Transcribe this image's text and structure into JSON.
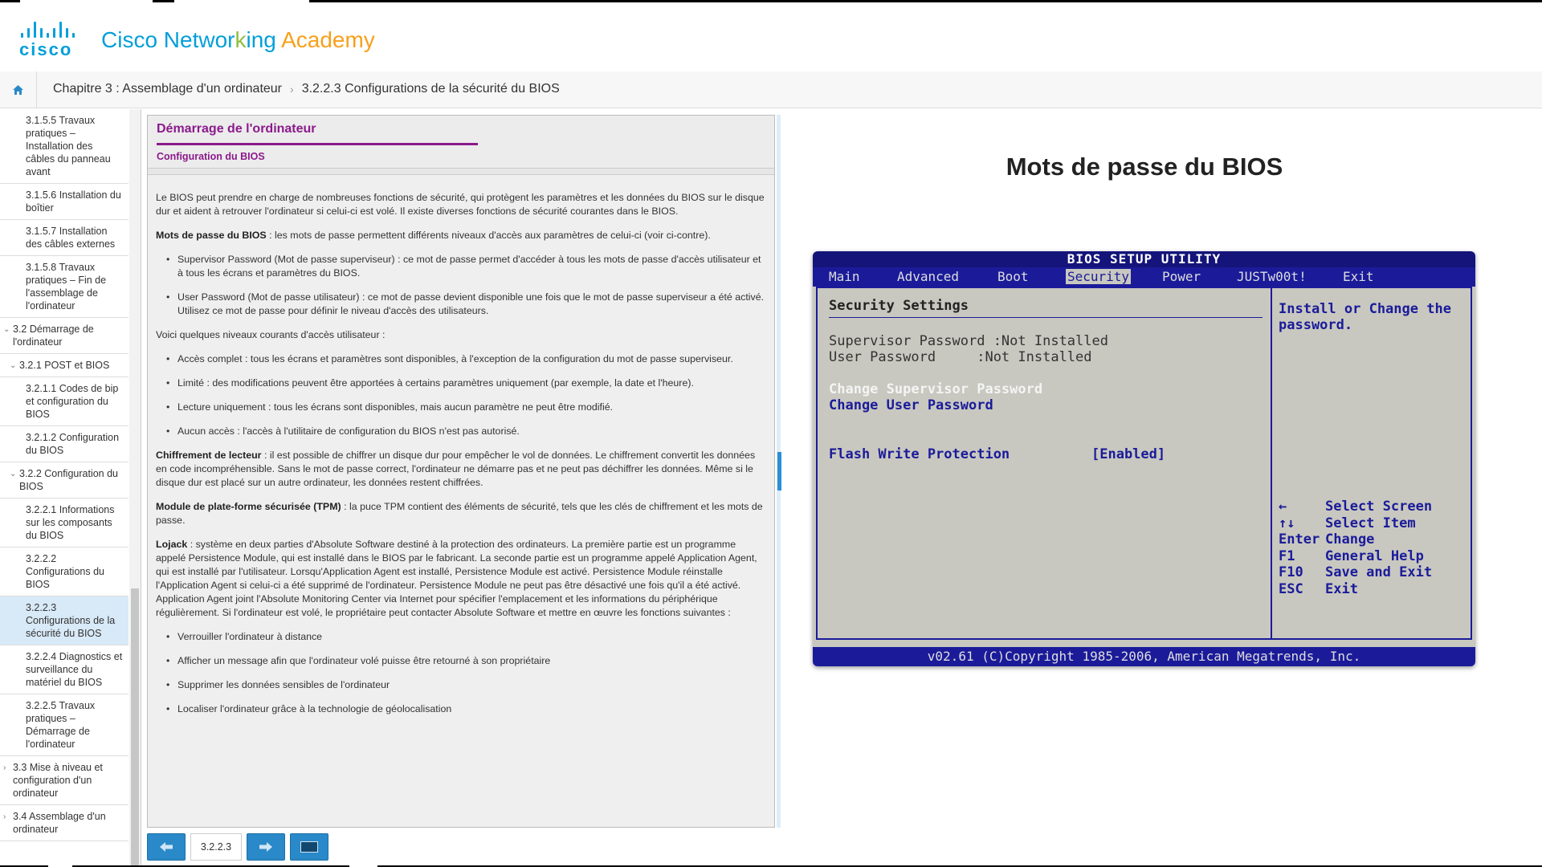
{
  "app": {
    "brand_word": "cisco",
    "title_prefix": "Cisco Networ",
    "title_o": "k",
    "title_mid": "ing",
    "title_a": " Academy"
  },
  "breadcrumb": {
    "items": [
      "Chapitre 3 : Assemblage d'un ordinateur",
      "3.2.2.3 Configurations de la sécurité du BIOS"
    ]
  },
  "sidebar": {
    "items": [
      {
        "label": "3.1.5.5 Travaux pratiques – Installation des câbles du panneau avant",
        "level": 3,
        "active": false
      },
      {
        "label": "3.1.5.6 Installation du boîtier",
        "level": 3,
        "active": false
      },
      {
        "label": "3.1.5.7 Installation des câbles externes",
        "level": 3,
        "active": false
      },
      {
        "label": "3.1.5.8 Travaux pratiques – Fin de l'assemblage de l'ordinateur",
        "level": 3,
        "active": false
      },
      {
        "label": "3.2 Démarrage de l'ordinateur",
        "level": 1,
        "chevron": "down",
        "active": false
      },
      {
        "label": "3.2.1 POST et BIOS",
        "level": 2,
        "chevron": "down",
        "active": false
      },
      {
        "label": "3.2.1.1 Codes de bip et configuration du BIOS",
        "level": 3,
        "active": false
      },
      {
        "label": "3.2.1.2 Configuration du BIOS",
        "level": 3,
        "active": false
      },
      {
        "label": "3.2.2 Configuration du BIOS",
        "level": 2,
        "chevron": "down",
        "active": false
      },
      {
        "label": "3.2.2.1 Informations sur les composants du BIOS",
        "level": 3,
        "active": false
      },
      {
        "label": "3.2.2.2 Configurations du BIOS",
        "level": 3,
        "active": false
      },
      {
        "label": "3.2.2.3 Configurations de la sécurité du BIOS",
        "level": 3,
        "active": true
      },
      {
        "label": "3.2.2.4 Diagnostics et surveillance du matériel du BIOS",
        "level": 3,
        "active": false
      },
      {
        "label": "3.2.2.5 Travaux pratiques – Démarrage de l'ordinateur",
        "level": 3,
        "active": false
      },
      {
        "label": "3.3 Mise à niveau et configuration d'un ordinateur",
        "level": 1,
        "chevron": "right",
        "active": false
      },
      {
        "label": "3.4 Assemblage d'un ordinateur",
        "level": 1,
        "chevron": "right",
        "active": false
      }
    ]
  },
  "panel": {
    "title": "Démarrage de l'ordinateur",
    "subtitle": "Configuration du BIOS",
    "intro": "Le BIOS peut prendre en charge de nombreuses fonctions de sécurité, qui protègent les paramètres et les données du BIOS sur le disque dur et aident à retrouver l'ordinateur si celui-ci est volé. Il existe diverses fonctions de sécurité courantes dans le BIOS.",
    "pw_term": "Mots de passe du BIOS",
    "pw_text": " : les mots de passe permettent différents niveaux d'accès aux paramètres de celui-ci (voir ci-contre).",
    "pw_list": [
      "Supervisor Password (Mot de passe superviseur) : ce mot de passe permet d'accéder à tous les mots de passe d'accès utilisateur et à tous les écrans et paramètres du BIOS.",
      "User Password (Mot de passe utilisateur) : ce mot de passe devient disponible une fois que le mot de passe superviseur a été activé. Utilisez ce mot de passe pour définir le niveau d'accès des utilisateurs."
    ],
    "levels_intro": "Voici quelques niveaux courants d'accès utilisateur :",
    "levels_list": [
      "Accès complet : tous les écrans et paramètres sont disponibles, à l'exception de la configuration du mot de passe superviseur.",
      "Limité : des modifications peuvent être apportées à certains paramètres uniquement (par exemple, la date et l'heure).",
      "Lecture uniquement : tous les écrans sont disponibles, mais aucun paramètre ne peut être modifié.",
      "Aucun accès : l'accès à l'utilitaire de configuration du BIOS n'est pas autorisé."
    ],
    "enc_term": "Chiffrement de lecteur",
    "enc_text": " : il est possible de chiffrer un disque dur pour empêcher le vol de données. Le chiffrement convertit les données en code incompréhensible. Sans le mot de passe correct, l'ordinateur ne démarre pas et ne peut pas déchiffrer les données. Même si le disque dur est placé sur un autre ordinateur, les données restent chiffrées.",
    "tpm_term": "Module de plate-forme sécurisée (TPM)",
    "tpm_text": " : la puce TPM contient des éléments de sécurité, tels que les clés de chiffrement et les mots de passe.",
    "lojack_term": "Lojack",
    "lojack_text": " : système en deux parties d'Absolute Software destiné à la protection des ordinateurs. La première partie est un programme appelé Persistence Module, qui est installé dans le BIOS par le fabricant. La seconde partie est un programme appelé Application Agent, qui est installé par l'utilisateur. Lorsqu'Application Agent est installé, Persistence Module est activé. Persistence Module réinstalle l'Application Agent si celui-ci a été supprimé de l'ordinateur. Persistence Module ne peut pas être désactivé une fois qu'il a été activé. Application Agent joint l'Absolute Monitoring Center via Internet pour spécifier l'emplacement et les informations du périphérique régulièrement. Si l'ordinateur est volé, le propriétaire peut contacter Absolute Software et mettre en œuvre les fonctions suivantes :",
    "lojack_list": [
      "Verrouiller l'ordinateur à distance",
      "Afficher un message afin que l'ordinateur volé puisse être retourné à son propriétaire",
      "Supprimer les données sensibles de l'ordinateur",
      "Localiser l'ordinateur grâce à la technologie de géolocalisation"
    ]
  },
  "nav": {
    "page": "3.2.2.3"
  },
  "media": {
    "title": "Mots de passe du BIOS",
    "bios": {
      "title": "BIOS SETUP UTILITY",
      "menus": [
        "Main",
        "Advanced",
        "Boot",
        "Security",
        "Power",
        "JUSTw00t!",
        "Exit"
      ],
      "selected_menu": "Security",
      "heading": "Security Settings",
      "sup_pw": "Supervisor Password :Not Installed",
      "user_pw": "User Password     :Not Installed",
      "change_sup": "Change Supervisor Password",
      "change_user": "Change User Password",
      "flash_label": "Flash Write Protection",
      "flash_value": "[Enabled]",
      "help": "Install or Change the password.",
      "keys": [
        {
          "key": "←",
          "action": "Select Screen"
        },
        {
          "key": "↑↓",
          "action": "Select Item"
        },
        {
          "key": "Enter",
          "action": "Change"
        },
        {
          "key": "F1",
          "action": "General Help"
        },
        {
          "key": "F10",
          "action": "Save and Exit"
        },
        {
          "key": "ESC",
          "action": "Exit"
        }
      ],
      "footer": "v02.61 (C)Copyright 1985-2006, American Megatrends, Inc."
    }
  },
  "colors": {
    "brand_blue": "#049fd9",
    "accent_purple": "#8b1a8b",
    "bios_blue": "#1b1b9a",
    "nav_blue": "#2a89c8"
  }
}
